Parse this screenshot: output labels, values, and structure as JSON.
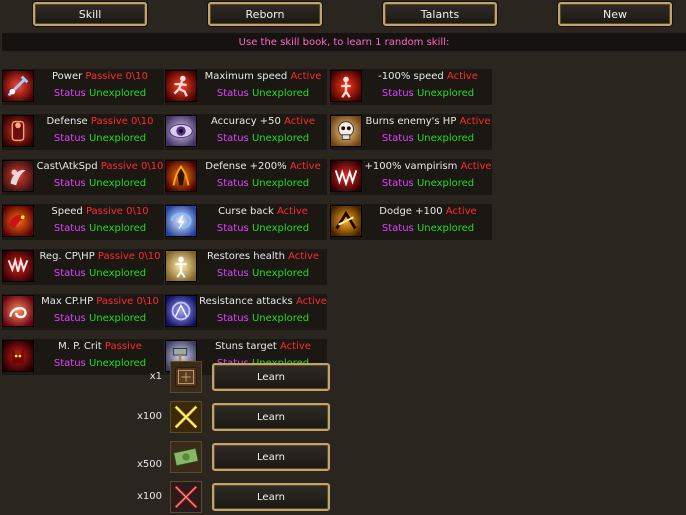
{
  "tabs": [
    "Skill",
    "Reborn",
    "Talants",
    "New"
  ],
  "banner": "Use the skill book, to learn 1 random skill:",
  "status_label": "Status",
  "columns": [
    [
      {
        "name": "Power",
        "type": "Passive 0\\10",
        "status": "Unexplored",
        "icon": "power-icon"
      },
      {
        "name": "Defense",
        "type": "Passive 0\\10",
        "status": "Unexplored",
        "icon": "armor-icon"
      },
      {
        "name": "Cast\\AtkSpd",
        "type": "Passive 0\\10",
        "status": "Unexplored",
        "icon": "claw-icon"
      },
      {
        "name": "Speed",
        "type": "Passive 0\\10",
        "status": "Unexplored",
        "icon": "dragon-icon"
      },
      {
        "name": "Reg. CP\\HP",
        "type": "Passive 0\\10",
        "status": "Unexplored",
        "icon": "fangs-icon"
      },
      {
        "name": "Max CP.HP",
        "type": "Passive 0\\10",
        "status": "Unexplored",
        "icon": "fire-swirl-icon"
      },
      {
        "name": "M. P. Crit",
        "type": "Passive",
        "status": "Unexplored",
        "icon": "demon-icon"
      }
    ],
    [
      {
        "name": "Maximum speed",
        "type": "Active",
        "status": "Unexplored",
        "icon": "running-man-icon"
      },
      {
        "name": "Accuracy +50",
        "type": "Active",
        "status": "Unexplored",
        "icon": "eye-icon"
      },
      {
        "name": "Defense +200%",
        "type": "Active",
        "status": "Unexplored",
        "icon": "fire-warrior-icon"
      },
      {
        "name": "Curse back",
        "type": "Active",
        "status": "Unexplored",
        "icon": "lightning-swirl-icon"
      },
      {
        "name": "Restores health",
        "type": "Active",
        "status": "Unexplored",
        "icon": "light-figure-icon"
      },
      {
        "name": "Resistance attacks",
        "type": "Active",
        "status": "Unexplored",
        "icon": "blue-orb-icon"
      },
      {
        "name": "Stuns target",
        "type": "Active",
        "status": "Unexplored",
        "icon": "hammer-icon"
      }
    ],
    [
      {
        "name": "-100% speed",
        "type": "Active",
        "status": "Unexplored",
        "icon": "slow-icon"
      },
      {
        "name": "Burns enemy's HP",
        "type": "Active",
        "status": "Unexplored",
        "icon": "skull-icon"
      },
      {
        "name": "+100% vampirism",
        "type": "Active",
        "status": "Unexplored",
        "icon": "vampire-icon"
      },
      {
        "name": "Dodge +100",
        "type": "Active",
        "status": "Unexplored",
        "icon": "dodge-icon"
      }
    ]
  ],
  "learn_rows": [
    {
      "mult": "x1",
      "label": "Learn",
      "icon": "skill-book-icon"
    },
    {
      "mult": "x100",
      "label": "Learn",
      "icon": "crossed-swords-icon"
    },
    {
      "mult": "x500",
      "label": "Learn",
      "icon": "money-icon"
    },
    {
      "mult": "x100",
      "label": "Learn",
      "icon": "red-swords-icon"
    }
  ],
  "colors": {
    "passive": "#ff2a2a",
    "active": "#ff2a2a",
    "status_label": "#e040ff",
    "status_value": "#22dd22",
    "banner": "#ff66cc",
    "button_border": "#c2a46a"
  }
}
